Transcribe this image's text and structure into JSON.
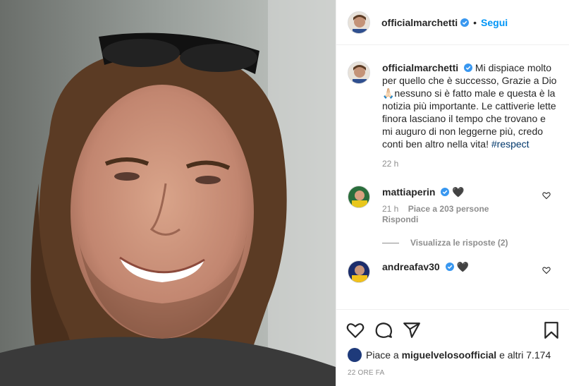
{
  "post": {
    "username": "officialmarchetti",
    "follow_label": "Segui",
    "separator": "•",
    "caption_text": "Mi dispiace molto per quello che è successo, Grazie a Dio🙏🏻nessuno si è fatto male e questa è la notizia più importante. Le cattiverie lette finora lasciano il tempo che trovano e mi auguro di non leggerne più, credo conti ben altro nella vita!",
    "caption_hashtag": "#respect",
    "caption_time": "22 h"
  },
  "comments": [
    {
      "username": "mattiaperin",
      "text": "🖤",
      "time": "21 h",
      "likes": "Piace a 203 persone",
      "reply_label": "Rispondi",
      "view_replies": "Visualizza le risposte (2)"
    },
    {
      "username": "andreafav30",
      "text": "🖤"
    }
  ],
  "footer": {
    "likes_prefix": "Piace a",
    "likes_user": "miguelvelosoofficial",
    "likes_suffix": "e altri 7.174",
    "date": "22 ORE FA"
  },
  "icons": {
    "verified": "verified-badge-icon",
    "like": "heart-icon",
    "comment": "comment-icon",
    "share": "share-icon",
    "save": "bookmark-icon"
  },
  "colors": {
    "link": "#0095f6",
    "verified": "#3897f0",
    "muted": "#8e8e8e",
    "text": "#262626"
  }
}
